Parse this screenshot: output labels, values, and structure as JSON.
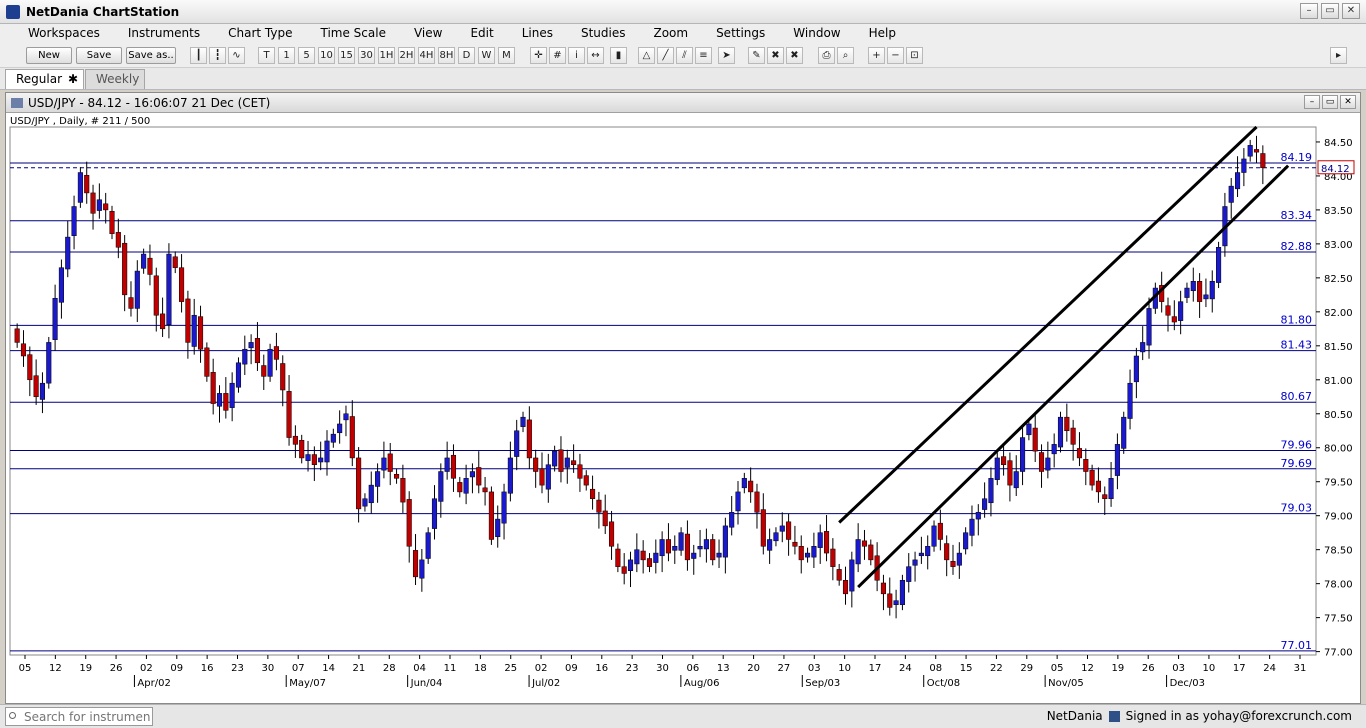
{
  "app": {
    "title": "NetDania ChartStation"
  },
  "window_controls": {
    "minimize": "–",
    "restore": "▭",
    "close": "✕"
  },
  "menu": [
    "Workspaces",
    "Instruments",
    "Chart Type",
    "Time Scale",
    "View",
    "Edit",
    "Lines",
    "Studies",
    "Zoom",
    "Settings",
    "Window",
    "Help"
  ],
  "toolbar": {
    "new_label": "New",
    "save_label": "Save",
    "save_as_label": "Save as..",
    "timescale_buttons": [
      "T",
      "1",
      "5",
      "10",
      "15",
      "30",
      "1H",
      "2H",
      "4H",
      "8H",
      "D",
      "W",
      "M"
    ],
    "icons": [
      "bar-chart-icon",
      "candle-chart-icon",
      "line-chart-icon",
      "crosshair-icon",
      "grid-icon",
      "info-icon",
      "arrows-icon",
      "volume-icon",
      "bell-icon",
      "trendline-icon",
      "channel-icon",
      "fibonacci-icon",
      "cursor-icon",
      "pen-icon",
      "delete-icon",
      "delete-all-icon",
      "print-icon",
      "print-preview-icon",
      "zoom-in-icon",
      "zoom-out-icon",
      "zoom-fit-icon",
      "panel-toggle-icon"
    ]
  },
  "tabs": [
    {
      "label": "Regular"
    },
    {
      "label": "Weekly"
    }
  ],
  "chart_window": {
    "title": "USD/JPY - 84.12 - 16:06:07  21 Dec (CET)"
  },
  "status": {
    "search_placeholder": "Search for instrument",
    "brand": "NetDania",
    "signed_in": "Signed in as yohay@forexcrunch.com"
  },
  "chart_data": {
    "type": "candlestick",
    "instrument_label": "USD/JPY , Daily, # 211 / 500",
    "ylim": [
      76.95,
      84.72
    ],
    "yticks": [
      77.0,
      77.5,
      78.0,
      78.5,
      79.0,
      79.5,
      80.0,
      80.5,
      81.0,
      81.5,
      82.0,
      82.5,
      83.0,
      83.5,
      84.0,
      84.5
    ],
    "x_tick_labels": [
      "05",
      "12",
      "19",
      "26",
      "02",
      "09",
      "16",
      "23",
      "30",
      "07",
      "14",
      "21",
      "28",
      "04",
      "11",
      "18",
      "25",
      "02",
      "09",
      "16",
      "23",
      "30",
      "06",
      "13",
      "20",
      "27",
      "03",
      "10",
      "17",
      "24",
      "08",
      "15",
      "22",
      "29",
      "05",
      "12",
      "19",
      "26",
      "03",
      "10",
      "17",
      "24",
      "31"
    ],
    "x_month_labels": [
      {
        "label": "Apr/02",
        "after_tick": 4
      },
      {
        "label": "May/07",
        "after_tick": 9
      },
      {
        "label": "Jun/04",
        "after_tick": 13
      },
      {
        "label": "Jul/02",
        "after_tick": 17
      },
      {
        "label": "Aug/06",
        "after_tick": 22
      },
      {
        "label": "Sep/03",
        "after_tick": 26
      },
      {
        "label": "Oct/08",
        "after_tick": 30
      },
      {
        "label": "Nov/05",
        "after_tick": 34
      },
      {
        "label": "Dec/03",
        "after_tick": 38
      }
    ],
    "horizontal_levels": [
      {
        "value": 84.19,
        "label": "84.19",
        "style": "solid"
      },
      {
        "value": 83.34,
        "label": "83.34",
        "style": "solid"
      },
      {
        "value": 82.88,
        "label": "82.88",
        "style": "solid"
      },
      {
        "value": 81.8,
        "label": "81.80",
        "style": "solid"
      },
      {
        "value": 81.43,
        "label": "81.43",
        "style": "solid"
      },
      {
        "value": 80.67,
        "label": "80.67",
        "style": "solid"
      },
      {
        "value": 79.96,
        "label": "79.96",
        "style": "solid"
      },
      {
        "value": 79.69,
        "label": "79.69",
        "style": "solid"
      },
      {
        "value": 79.03,
        "label": "79.03",
        "style": "solid"
      },
      {
        "value": 77.01,
        "label": "77.01",
        "style": "solid"
      }
    ],
    "current_price": {
      "value": 84.12,
      "label": "84.12"
    },
    "channel": {
      "upper": {
        "start": {
          "bar": 130,
          "value": 78.9
        },
        "end": {
          "bar": 196,
          "value": 84.72
        }
      },
      "lower": {
        "start": {
          "bar": 133,
          "value": 77.95
        },
        "end": {
          "bar": 201,
          "value": 84.15
        }
      }
    },
    "colors": {
      "up": "#1a1acc",
      "down": "#c00000",
      "level": "#00007f",
      "channel": "#000000",
      "label": "#0000cc"
    },
    "closes": [
      81.55,
      81.35,
      81.0,
      80.75,
      80.95,
      81.55,
      82.2,
      82.65,
      83.1,
      83.55,
      84.05,
      83.75,
      83.45,
      83.65,
      83.5,
      83.15,
      82.95,
      82.25,
      82.05,
      82.6,
      82.85,
      82.55,
      81.95,
      81.75,
      82.85,
      82.65,
      82.15,
      81.55,
      81.95,
      81.45,
      81.05,
      80.65,
      80.8,
      80.55,
      80.95,
      81.25,
      81.45,
      81.55,
      81.25,
      81.05,
      81.45,
      81.3,
      80.85,
      80.15,
      80.05,
      79.85,
      79.9,
      79.75,
      79.85,
      80.1,
      80.2,
      80.35,
      80.5,
      79.85,
      79.1,
      79.25,
      79.45,
      79.65,
      79.85,
      79.65,
      79.55,
      79.2,
      78.55,
      78.1,
      78.35,
      78.75,
      79.25,
      79.65,
      79.85,
      79.55,
      79.35,
      79.55,
      79.65,
      79.45,
      79.35,
      78.65,
      78.95,
      79.35,
      79.85,
      80.25,
      80.45,
      79.85,
      79.65,
      79.45,
      79.75,
      79.95,
      79.65,
      79.85,
      79.75,
      79.55,
      79.45,
      79.25,
      79.05,
      78.85,
      78.55,
      78.25,
      78.15,
      78.35,
      78.5,
      78.35,
      78.25,
      78.45,
      78.65,
      78.45,
      78.55,
      78.75,
      78.35,
      78.45,
      78.55,
      78.65,
      78.35,
      78.45,
      78.85,
      79.05,
      79.35,
      79.55,
      79.35,
      79.05,
      78.55,
      78.65,
      78.75,
      78.85,
      78.65,
      78.55,
      78.35,
      78.45,
      78.55,
      78.75,
      78.45,
      78.25,
      78.05,
      77.85,
      78.35,
      78.65,
      78.55,
      78.35,
      78.05,
      77.85,
      77.65,
      77.75,
      78.05,
      78.25,
      78.35,
      78.45,
      78.55,
      78.85,
      78.65,
      78.35,
      78.25,
      78.45,
      78.75,
      78.95,
      79.05,
      79.25,
      79.55,
      79.85,
      79.75,
      79.45,
      79.65,
      80.15,
      80.35,
      79.95,
      79.65,
      79.85,
      80.05,
      80.45,
      80.25,
      80.05,
      79.85,
      79.65,
      79.45,
      79.35,
      79.25,
      79.55,
      80.05,
      80.45,
      80.95,
      81.35,
      81.55,
      82.05,
      82.35,
      82.15,
      81.95,
      81.85,
      82.15,
      82.35,
      82.45,
      82.15,
      82.25,
      82.45,
      82.95,
      83.55,
      83.85,
      84.05,
      84.25,
      84.45,
      84.35,
      84.12
    ]
  }
}
